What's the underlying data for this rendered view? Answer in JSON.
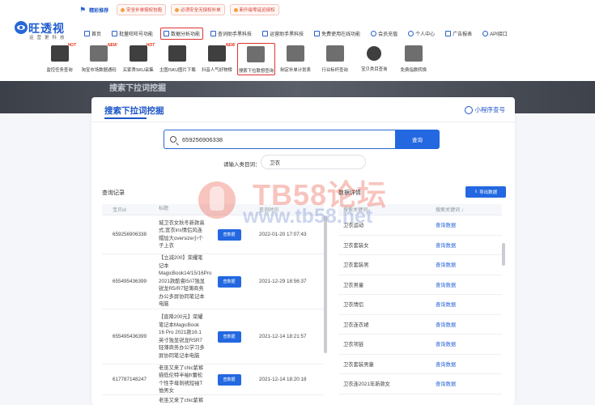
{
  "promo": {
    "title": "精彩推荐",
    "chips": [
      "安全补单授权包租",
      "必须安全无授权补单",
      "新升级零延迟授权"
    ]
  },
  "logo": {
    "name": "旺透视",
    "sub": "运营更科技"
  },
  "nav_primary": [
    {
      "label": "首页",
      "icon": "home-icon"
    },
    {
      "label": "批量旺旺号功能",
      "icon": "batch-icon"
    },
    {
      "label": "数据分析功能",
      "icon": "data-icon"
    },
    {
      "label": "查词助手黑科技",
      "icon": "keyword-icon"
    },
    {
      "label": "运营助手黑科技",
      "icon": "ops-icon"
    },
    {
      "label": "免费使用在线功能",
      "icon": "free-icon"
    },
    {
      "label": "会员充值",
      "icon": "vip-icon"
    },
    {
      "label": "个人中心",
      "icon": "user-icon"
    },
    {
      "label": "广告报表",
      "icon": "report-icon"
    },
    {
      "label": "API接口",
      "icon": "api-icon"
    }
  ],
  "nav_tools": [
    {
      "label": "监控任务查询",
      "badge": "HOT"
    },
    {
      "label": "淘宝市场数据通码",
      "badge": "NEW"
    },
    {
      "label": "买家秀SKU采集",
      "badge": "HOT"
    },
    {
      "label": "主图/SKU图片下载",
      "badge": ""
    },
    {
      "label": "抖音人气好物榜",
      "badge": "NEW"
    },
    {
      "label": "搜索下拉联想查询",
      "badge": ""
    },
    {
      "label": "制定补单计划表",
      "badge": ""
    },
    {
      "label": "行业标杆查询",
      "badge": ""
    },
    {
      "label": "宝贝类目查询",
      "badge": ""
    },
    {
      "label": "免费指数转换",
      "badge": ""
    }
  ],
  "banner": {
    "ghost_text": "搜索下拉词挖掘"
  },
  "page": {
    "title": "搜索下拉词挖掘",
    "mini_program": "小程序查号",
    "search_value": "659256906338",
    "search_button": "查询",
    "category_label": "请输入类目词：",
    "category_value": "卫衣"
  },
  "history": {
    "title": "查询记录",
    "columns": [
      "宝贝id",
      "标题",
      "",
      "查询时间"
    ],
    "query_button": "查数据",
    "rows": [
      {
        "id": "659256906338",
        "title": "城卫衣女秋冬新款高式,宽衣ins情侣风连帽加大oversize小个子上衣",
        "time": "2022-01-20 17:07:43"
      },
      {
        "id": "655495436399",
        "title": "【立减200】荣耀笔记本MagicBook14/15/16Pro 2021款酷睿i5/i7独显锐龙R5/R7轻薄商务办公多屏协同笔记本电脑",
        "time": "2021-12-29 18:56:37"
      },
      {
        "id": "655495436399",
        "title": "【直降200元】荣耀笔记本MagicBook 16 Pro 2021款16.1英寸独显锐龙R5R7轻薄商务办公学习多屏协同笔记本电脑",
        "time": "2021-12-14 18:21:57"
      },
      {
        "id": "617787148247",
        "title": "老巫又来了chic紫裤描低伦特半袖fr蕾松个性字母刺绣短袖T恤男女",
        "time": "2021-12-14 18:20:18"
      },
      {
        "id": "",
        "title": "老巫又来了chic紫裤描",
        "time": ""
      }
    ]
  },
  "results": {
    "title": "数据详情",
    "export_button": "导出数据",
    "columns": [
      "搜索关键词",
      "搜索关键词 ↕"
    ],
    "action_label": "查询数据",
    "rows": [
      "卫衣运动",
      "卫衣套装女",
      "卫衣套装男",
      "卫衣男童",
      "卫衣情侣",
      "卫衣连衣裙",
      "卫衣项链",
      "卫衣套装男童",
      "卫衣连2021年新款女"
    ]
  },
  "watermark": {
    "main": "TB58论坛",
    "url": "www.tb58.net"
  }
}
